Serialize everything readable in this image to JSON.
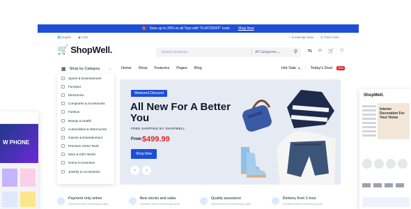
{
  "promo": {
    "text": "Save up to 20% on all Toys with \"FLAT20OFF\" code",
    "cta": "Shop Now",
    "gift_icon": "gift-icon"
  },
  "util": {
    "language": "English",
    "currency": "USD",
    "knowledge": "Knowledge Base",
    "track": "Track Order"
  },
  "brand": {
    "name": "ShopWell.",
    "accent": "#1d4ed8",
    "sale": "#dc2626"
  },
  "search": {
    "placeholder": "Search products...",
    "category": "All Categories"
  },
  "header_icons": [
    "compare-icon",
    "user-icon",
    "cart-icon",
    "wishlist-icon"
  ],
  "categories": {
    "title": "Shop by Category",
    "items": [
      "Sports & Entertainment",
      "Furniture",
      "Electronics",
      "Computers & Accessories",
      "Fashion",
      "Beauty & Health",
      "Automobiles & Motorcycles",
      "Games & Entertainment",
      "Premium Home Tools",
      "Mom & Kid's World",
      "Home Accessories",
      "Jewelry & Accessories"
    ]
  },
  "nav": {
    "links": [
      "Home",
      "Shop",
      "Features",
      "Pages",
      "Blog"
    ],
    "hot_sale": "Hot Sale",
    "todays_deal": "Today's Deal",
    "new_badge": "NEW"
  },
  "hero": {
    "pill": "Weekend Discount",
    "title": "All New For A Better You",
    "subtitle": "FREE SHIPPING BY SHOPWELL",
    "from_label": "From",
    "price": "$499.99",
    "cta": "Shop Now"
  },
  "features": [
    {
      "title": "Payment only online",
      "sub": "Tincidunt lorem scelerisque quis"
    },
    {
      "title": "New stocks and sales",
      "sub": "Tincidunt lorem scelerisque quis"
    },
    {
      "title": "Quality assurance",
      "sub": "Tincidunt lorem scelerisque quis"
    },
    {
      "title": "Delivery from 1 hour",
      "sub": "Tincidunt lorem scelerisque quis"
    }
  ],
  "left_preview": {
    "hero_text": "W PHONE"
  },
  "right_preview": {
    "logo": "ShopWell.",
    "hero_text": "Interior Decoration For Your Home"
  }
}
